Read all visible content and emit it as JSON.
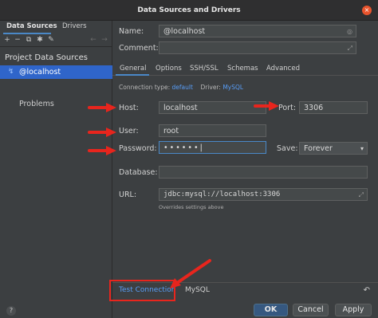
{
  "window": {
    "title": "Data Sources and Drivers",
    "close_glyph": "×"
  },
  "left": {
    "tabs": [
      "Data Sources",
      "Drivers"
    ],
    "toolbar_icons": [
      "add-icon",
      "remove-icon",
      "duplicate-icon",
      "settings-icon",
      "edit-icon",
      "back-icon",
      "forward-icon"
    ],
    "section": "Project Data Sources",
    "item": "@localhost",
    "item_icon": "↯",
    "problems": "Problems",
    "help": "?"
  },
  "form": {
    "name_label": "Name:",
    "name_value": "@localhost",
    "comment_label": "Comment:",
    "comment_value": "",
    "tabs": [
      "General",
      "Options",
      "SSH/SSL",
      "Schemas",
      "Advanced"
    ],
    "connection_type_label": "Connection type:",
    "connection_type_value": "default",
    "driver_label": "Driver:",
    "driver_value": "MySQL",
    "host_label": "Host:",
    "host_value": "localhost",
    "port_label": "Port:",
    "port_value": "3306",
    "user_label": "User:",
    "user_value": "root",
    "password_label": "Password:",
    "password_value": "••••••",
    "save_label": "Save:",
    "save_value": "Forever",
    "database_label": "Database:",
    "database_value": "",
    "url_label": "URL:",
    "url_value": "jdbc:mysql://localhost:3306",
    "url_note": "Overrides settings above"
  },
  "bottom": {
    "test_connection": "Test Connection",
    "driver_tab": "MySQL",
    "undo": "↶"
  },
  "buttons": {
    "ok": "OK",
    "cancel": "Cancel",
    "apply": "Apply"
  },
  "colors": {
    "accent": "#4a88c7",
    "link": "#589df6",
    "annotation": "#e8251d",
    "selection": "#2f65ca"
  }
}
